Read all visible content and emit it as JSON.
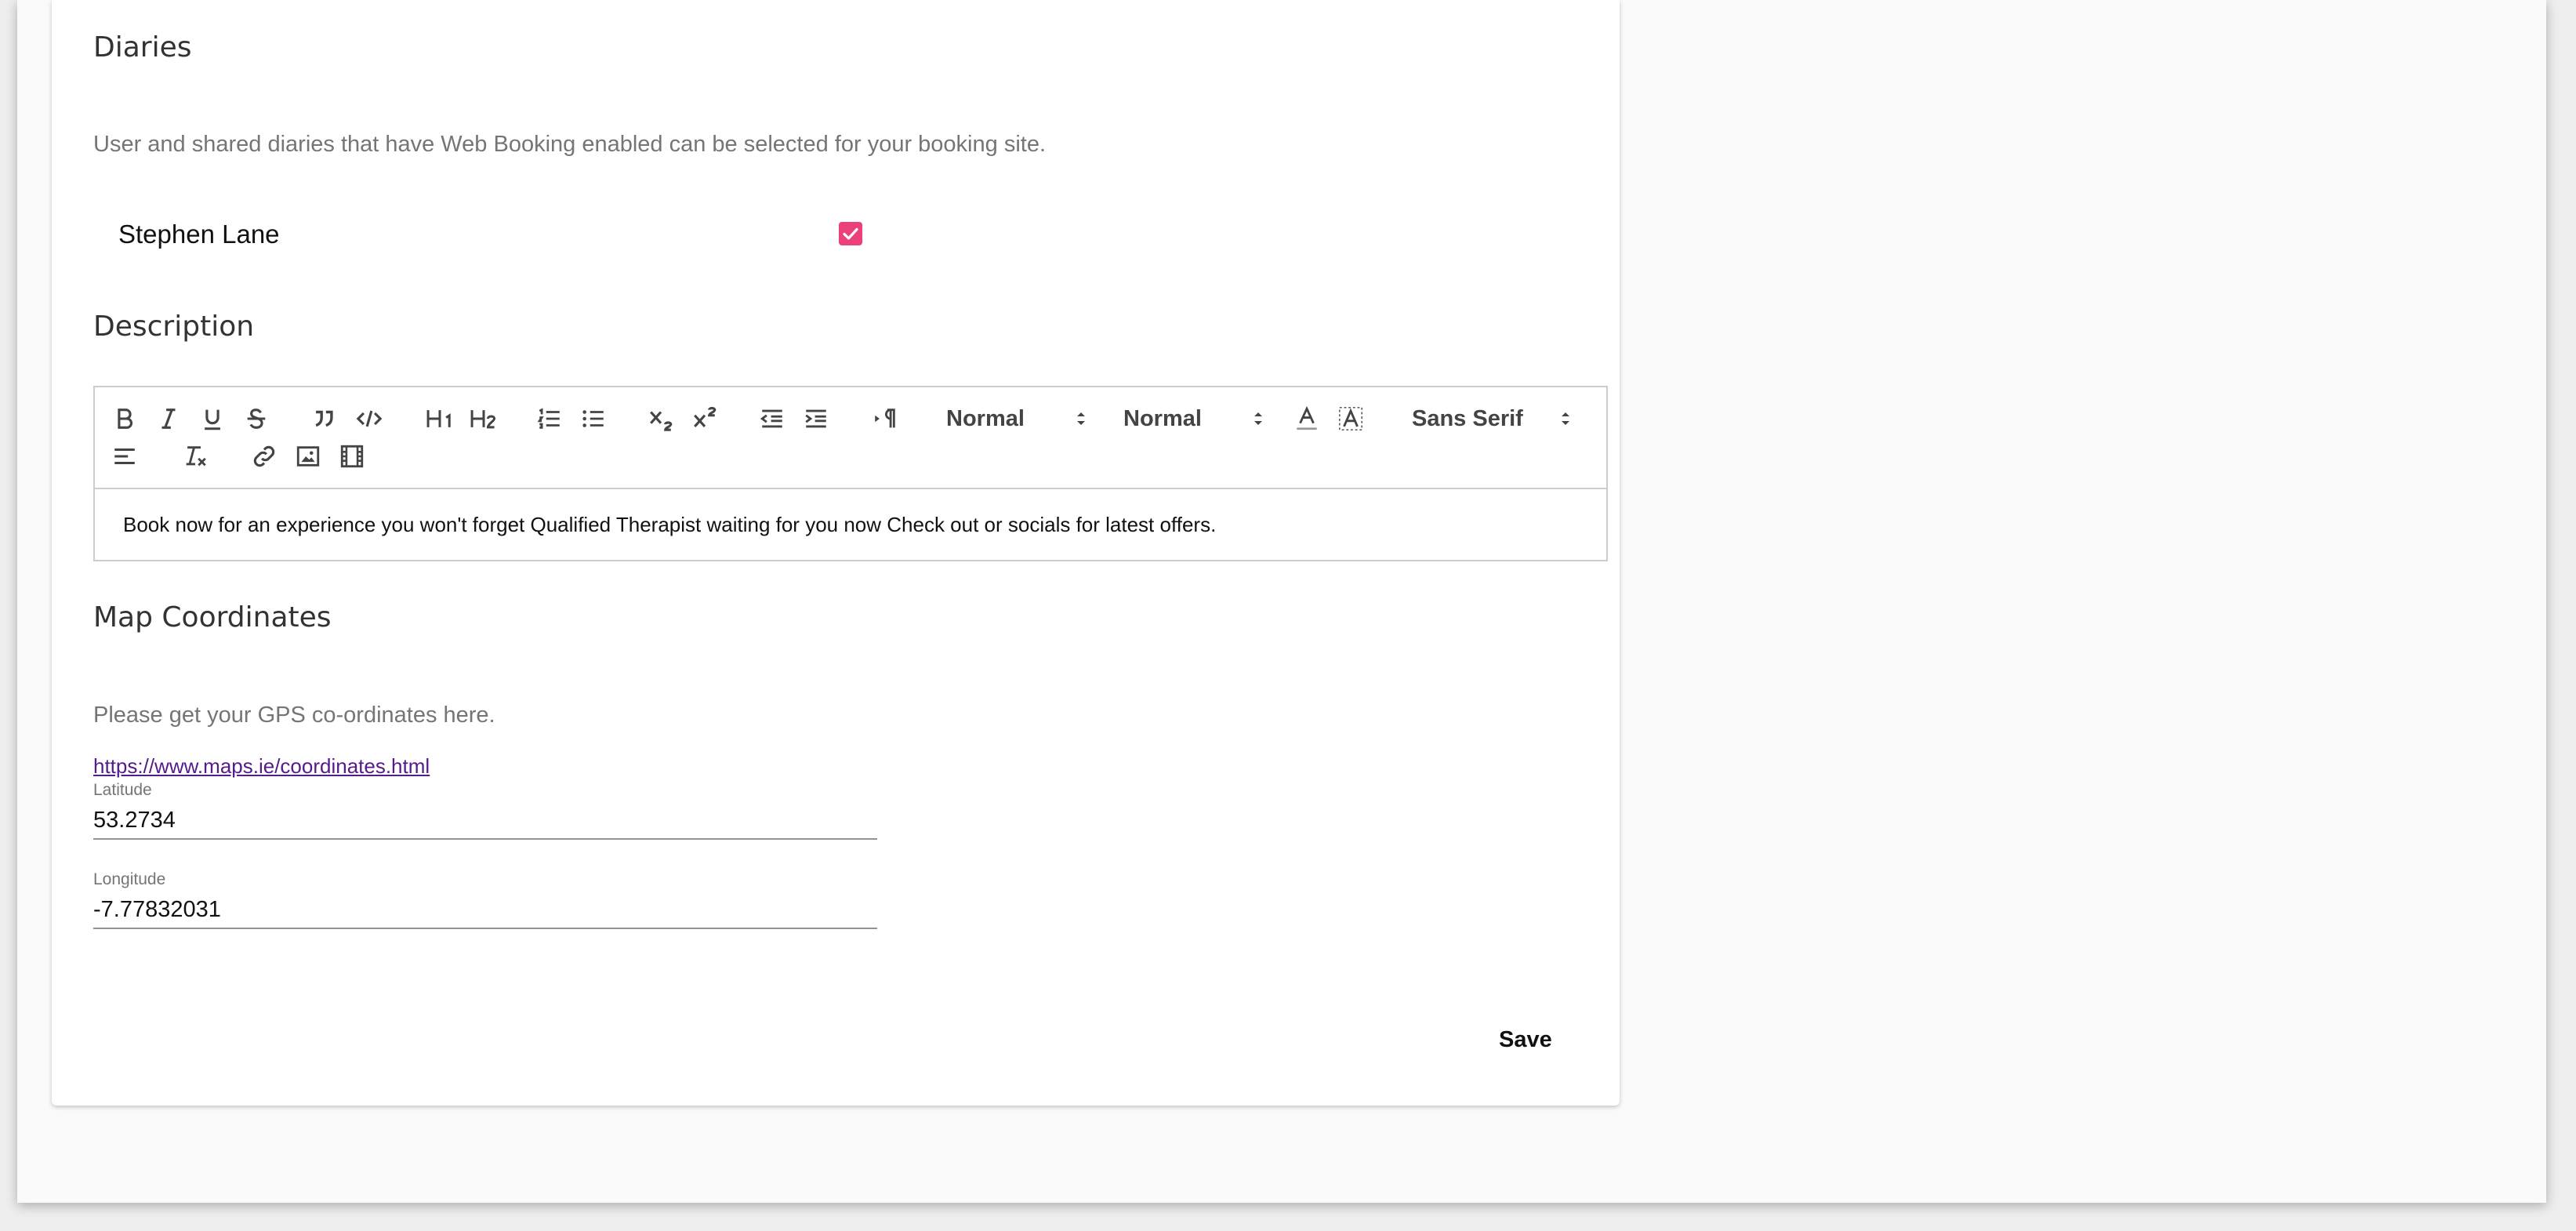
{
  "diaries": {
    "title": "Diaries",
    "help": "User and shared diaries that have Web Booking enabled can be selected for your booking site.",
    "items": [
      {
        "name": "Stephen Lane",
        "checked": true
      }
    ]
  },
  "description": {
    "title": "Description",
    "toolbar": {
      "header_size": "Normal",
      "font_size": "Normal",
      "font_family": "Sans Serif",
      "icons": [
        "bold-icon",
        "italic-icon",
        "underline-icon",
        "strike-icon",
        "blockquote-icon",
        "code-icon",
        "h1-icon",
        "h2-icon",
        "ordered-list-icon",
        "bullet-list-icon",
        "subscript-icon",
        "superscript-icon",
        "outdent-icon",
        "indent-icon",
        "rtl-icon",
        "text-color-icon",
        "background-color-icon",
        "align-left-icon",
        "clear-format-icon",
        "link-icon",
        "image-icon",
        "video-icon"
      ]
    },
    "content": "Book now for an experience you won't forget Qualified Therapist waiting for you now Check out or socials for latest offers."
  },
  "map": {
    "title": "Map Coordinates",
    "help": "Please get your GPS co-ordinates here.",
    "link": "https://www.maps.ie/coordinates.html",
    "latitude_label": "Latitude",
    "latitude": "53.2734",
    "longitude_label": "Longitude",
    "longitude": "-7.77832031"
  },
  "actions": {
    "save": "Save"
  },
  "colors": {
    "accent": "#ec407a",
    "link": "#551a8b"
  }
}
